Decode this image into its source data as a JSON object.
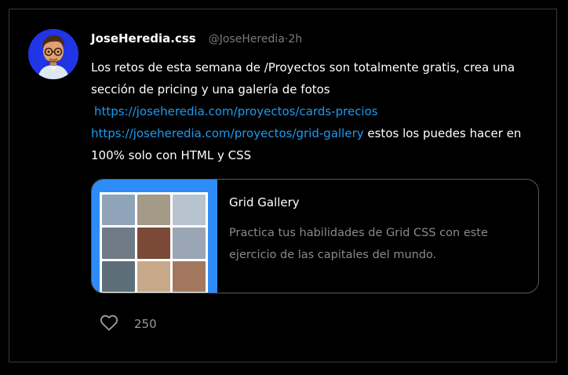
{
  "tweet": {
    "author_name": "JoseHeredia.css",
    "handle": "@JoseHeredia",
    "time": "·2h",
    "avatar_icon": "memoji-avatar-icon",
    "avatar_bg": "#1f35e6",
    "text_part1": "Los retos de esta semana de /Proyectos son totalmente gratis, crea una sección de pricing y una galería de fotos",
    "link1": "https://joseheredia.com/proyectos/cards-precios",
    "link2": "https://joseheredia.com/proyectos/grid-gallery",
    "text_part2": " estos los puedes hacer en 100% solo con HTML y CSS",
    "link_color": "#1d9bf0"
  },
  "card": {
    "title": "Grid Gallery",
    "description": "Practica tus habilidades de Grid CSS con este ejercicio de las capitales del mundo.",
    "image_bg": "#2d8cf7"
  },
  "actions": {
    "like_icon": "heart-icon",
    "like_count": "250"
  }
}
